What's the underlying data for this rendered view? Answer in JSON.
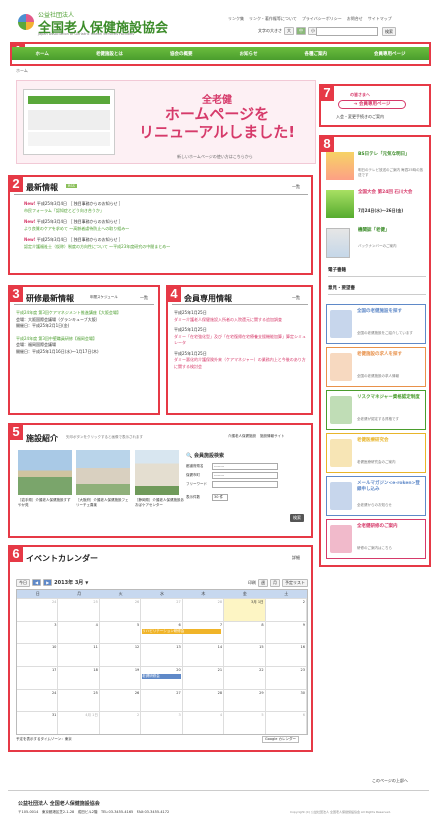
{
  "header": {
    "org_small": "公益社団法人",
    "org_name": "全国老人保健施設協会",
    "org_en": "Japan Association of Geriatric Health Services Facilities",
    "top_links": [
      "リンク集",
      "リンク・著作権等について",
      "プライバシーポリシー",
      "お問合せ",
      "サイトマップ"
    ],
    "font_size_label": "文字の大きさ",
    "font_sizes": [
      "大",
      "中",
      "小"
    ],
    "search_button": "検索"
  },
  "nav": {
    "items": [
      "ホーム",
      "老健施設とは",
      "協会の概要",
      "お知らせ",
      "各種ご案内",
      "会員専用ページ"
    ]
  },
  "breadcrumb": "ホーム",
  "banner": {
    "line1": "全老健",
    "line2": "ホームページを",
    "line3": "リニューアルしました!",
    "caption": "新しいホームページの使い方はこちらから"
  },
  "news": {
    "title": "最新情報",
    "rss": "RSS",
    "all": "一覧",
    "items": [
      {
        "badge": "New!",
        "date": "平成25年3月4日",
        "cat": "［ 独目事務からのお知らせ ］",
        "text": "市民フォーラム「認知症とどう向き合うか」"
      },
      {
        "badge": "New!",
        "date": "平成25年3月4日",
        "cat": "［ 独目事務からのお知らせ ］",
        "text": "より良質のケアを求めて 〜高齢者虐待防止への取り組み〜"
      },
      {
        "badge": "New!",
        "date": "平成25年3月4日",
        "cat": "［ 独目事務からのお知らせ ］",
        "text": "認定介護福祉士（仮称）制度の方向性について 〜平成23年度研究の中間まとめ〜"
      }
    ]
  },
  "training": {
    "title": "研修最新情報",
    "schedule": "年間スケジュール",
    "all": "一覧",
    "items": [
      {
        "title": "平成24年度 第3回ケアマネジメント推進講座【大阪会場】",
        "lines": [
          "会場：大阪国際会議場（グランキューブ大阪）",
          "開催日：平成25年2月1日(金)"
        ]
      },
      {
        "title": "平成24年度 第3回中堅職員研修【福岡会場】",
        "lines": [
          "会場：福岡国際会議場",
          "開催日：平成25年1月16日(水)〜1月17日(木)"
        ]
      }
    ]
  },
  "members": {
    "title": "会員専用情報",
    "all": "一覧",
    "items": [
      {
        "date": "平成25年1月25日",
        "text": "ダミー介護老人保健施設入所者の入院還元に関する追加調査"
      },
      {
        "date": "平成25年1月25日",
        "text": "ダミー「在宅強化型」及び「在宅復帰在宅療養支援機能加算」算定シミュレータ"
      },
      {
        "date": "平成25年1月25日",
        "text": "ダミー悪化的介護保険外来（ケアマネジャー）の業務内上と今後のあり方に関する検討会"
      }
    ]
  },
  "facilities": {
    "title": "施設紹介",
    "desc": "矢印ボタンをクリックすると画像で表示されます",
    "tabs": [
      "介護老人保健施設",
      "施設情報サイト"
    ],
    "photos": [
      {
        "caption": "［岩手県］介護老人保健施設すずやか苑"
      },
      {
        "caption": "［大阪府］介護老人保健施設フェリーチェ喜楽"
      },
      {
        "caption": "［静岡県］介護老人保健施設あおばケアセンター"
      }
    ],
    "search": {
      "title": "会員施設検索",
      "fields": [
        {
          "label": "都道府県名",
          "value": "--------"
        },
        {
          "label": "保健市町",
          "value": "--------"
        },
        {
          "label": "フリーワード",
          "value": ""
        },
        {
          "label": "表示件数",
          "value": "30 件"
        }
      ],
      "button": "検索"
    }
  },
  "calendar": {
    "title": "イベントカレンダー",
    "detail": "詳細",
    "today": "今日",
    "month_label": "2013年 3月",
    "print": "印刷",
    "views": [
      "週",
      "月",
      "予定リスト"
    ],
    "weekdays": [
      "日",
      "月",
      "火",
      "水",
      "木",
      "金",
      "土"
    ],
    "weeks": [
      [
        "24",
        "25",
        "26",
        "27",
        "28",
        "3月 1日",
        "2"
      ],
      [
        "3",
        "4",
        "5",
        "6",
        "7",
        "8",
        "9"
      ],
      [
        "10",
        "11",
        "12",
        "13",
        "14",
        "15",
        "16"
      ],
      [
        "17",
        "18",
        "19",
        "20",
        "21",
        "22",
        "23"
      ],
      [
        "24",
        "25",
        "26",
        "27",
        "28",
        "29",
        "30"
      ],
      [
        "31",
        "4月 1日",
        "2",
        "3",
        "4",
        "5",
        "6"
      ]
    ],
    "events": [
      "リハビリテーション研修会",
      "老健研修会"
    ],
    "tz": "予定を表示するタイムゾーン：東京",
    "gcal": "Google カレンダー"
  },
  "page_top": "このページの上部へ",
  "footer": {
    "org": "公益社団法人 全国老人保健施設協会",
    "address": "〒105-0014　東京都港区芝2-1-28　成田ビル2階　TEL:03-3455-4165　FAX:03-3455-4172",
    "copyright": "Copyright (C) 公益社団法人 全国老人保健施設協会 All Rights Reserved."
  },
  "sidebar": {
    "welcome": "の皆さまへ",
    "join_button": "会員専用ページ",
    "join_sub": "入会・変更手続きのご案内",
    "items": [
      {
        "title": "BS日テレ「元気な明日」",
        "sub": "明日のテレビ放送のご案内 毎週25時の放送です"
      },
      {
        "title": "全国大会 第24回 石川大会",
        "sub": "7月24日(水)〜26日(金)"
      },
      {
        "title": "機関誌「老健」",
        "sub": "バックナンバーのご案内"
      }
    ],
    "links": [
      "電子書籍",
      "意見・要望書"
    ],
    "boxes": [
      {
        "title": "全国の老健施設を探す",
        "sub": "全国の老健施設をご紹介しています"
      },
      {
        "title": "老健施設の求人を探す",
        "sub": "全国の老健施設の求人情報"
      },
      {
        "title": "リスクマネジャー資格認定制度",
        "sub": "全老健が認定する資格です"
      },
      {
        "title": "老健医療研究会",
        "sub": "老健医療研究会のご案内"
      },
      {
        "title": "メールマガジン<e-roken>登録申し込み",
        "sub": "全老健からのお知らせ"
      },
      {
        "title": "全老健研修のご案内",
        "sub": "研修のご案内はこちら"
      }
    ]
  },
  "annotations": [
    "1",
    "2",
    "3",
    "4",
    "5",
    "6",
    "7",
    "8"
  ]
}
